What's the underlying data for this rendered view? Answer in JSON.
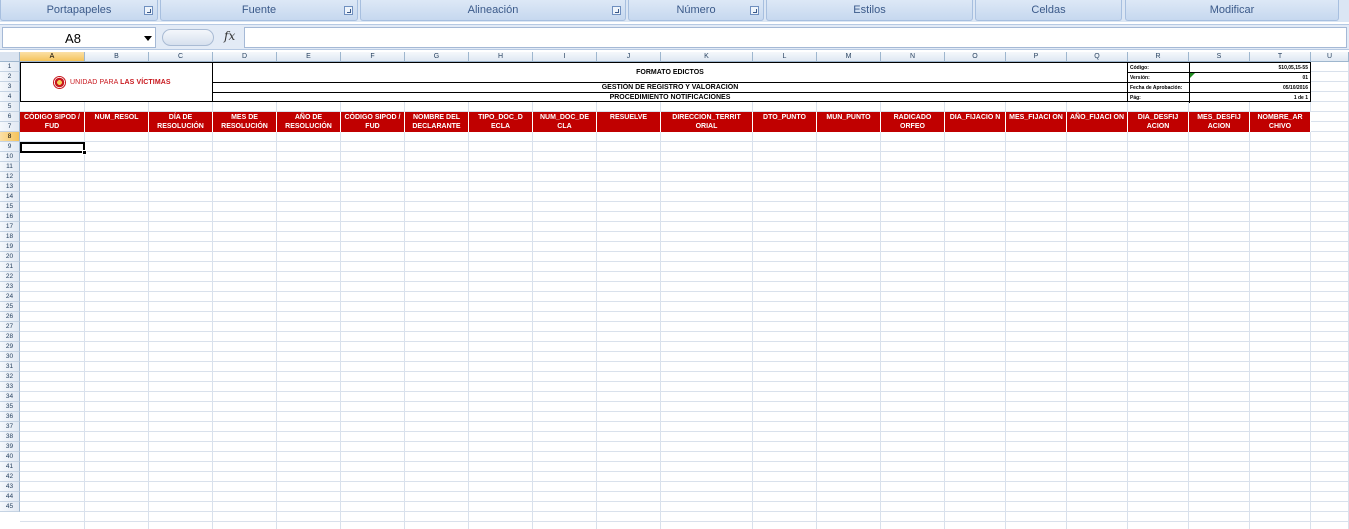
{
  "ribbon": {
    "groups": [
      {
        "label": "Portapapeles",
        "launcher": true
      },
      {
        "label": "Fuente",
        "launcher": true
      },
      {
        "label": "Alineación",
        "launcher": true
      },
      {
        "label": "Número",
        "launcher": true
      },
      {
        "label": "Estilos",
        "launcher": false
      },
      {
        "label": "Celdas",
        "launcher": false
      },
      {
        "label": "Modificar",
        "launcher": false
      }
    ]
  },
  "formula_bar": {
    "name_box": "A8",
    "fx_label": "fx",
    "formula": ""
  },
  "sheet": {
    "columns": [
      "A",
      "B",
      "C",
      "D",
      "E",
      "F",
      "G",
      "H",
      "I",
      "J",
      "K",
      "L",
      "M",
      "N",
      "O",
      "P",
      "Q",
      "R",
      "S",
      "T",
      "U"
    ],
    "selected_column": "A",
    "selected_row": "8",
    "row_count": 45
  },
  "document": {
    "logo": {
      "prefix": "UNIDAD PARA",
      "emphasis": "LAS VÍCTIMAS",
      "brand_color": "#c8171d"
    },
    "title": "FORMATO EDICTOS",
    "subtitle": "GESTIÓN DE REGISTRO Y VALORACIÓN",
    "procedure": "PROCEDIMIENTO NOTIFICACIONES",
    "meta": [
      {
        "key": "Código:",
        "value": "510,05,15-55"
      },
      {
        "key": "Versión:",
        "value": "01"
      },
      {
        "key": "Fecha de Aprobación:",
        "value": "05/10/2016"
      },
      {
        "key": "Pág:",
        "value": "1 de 1"
      }
    ]
  },
  "header_row": {
    "color": "#c00000",
    "cells": [
      "CÓDIGO SIPOD / FUD",
      "NUM_RESOL",
      "DÍA DE RESOLUCIÓN",
      "MES DE RESOLUCIÓN",
      "AÑO DE RESOLUCIÓN",
      "CÓDIGO SIPOD / FUD",
      "NOMBRE DEL DECLARANTE",
      "TIPO_DOC_D ECLA",
      "NUM_DOC_DE CLA",
      "RESUELVE",
      "DIRECCION_TERRIT ORIAL",
      "DTO_PUNTO",
      "MUN_PUNTO",
      "RADICADO ORFEO",
      "DIA_FIJACIO N",
      "MES_FIJACI ON",
      "AÑO_FIJACI ON",
      "DIA_DESFIJ ACION",
      "MES_DESFIJ ACION",
      "NOMBRE_AR CHIVO"
    ]
  }
}
